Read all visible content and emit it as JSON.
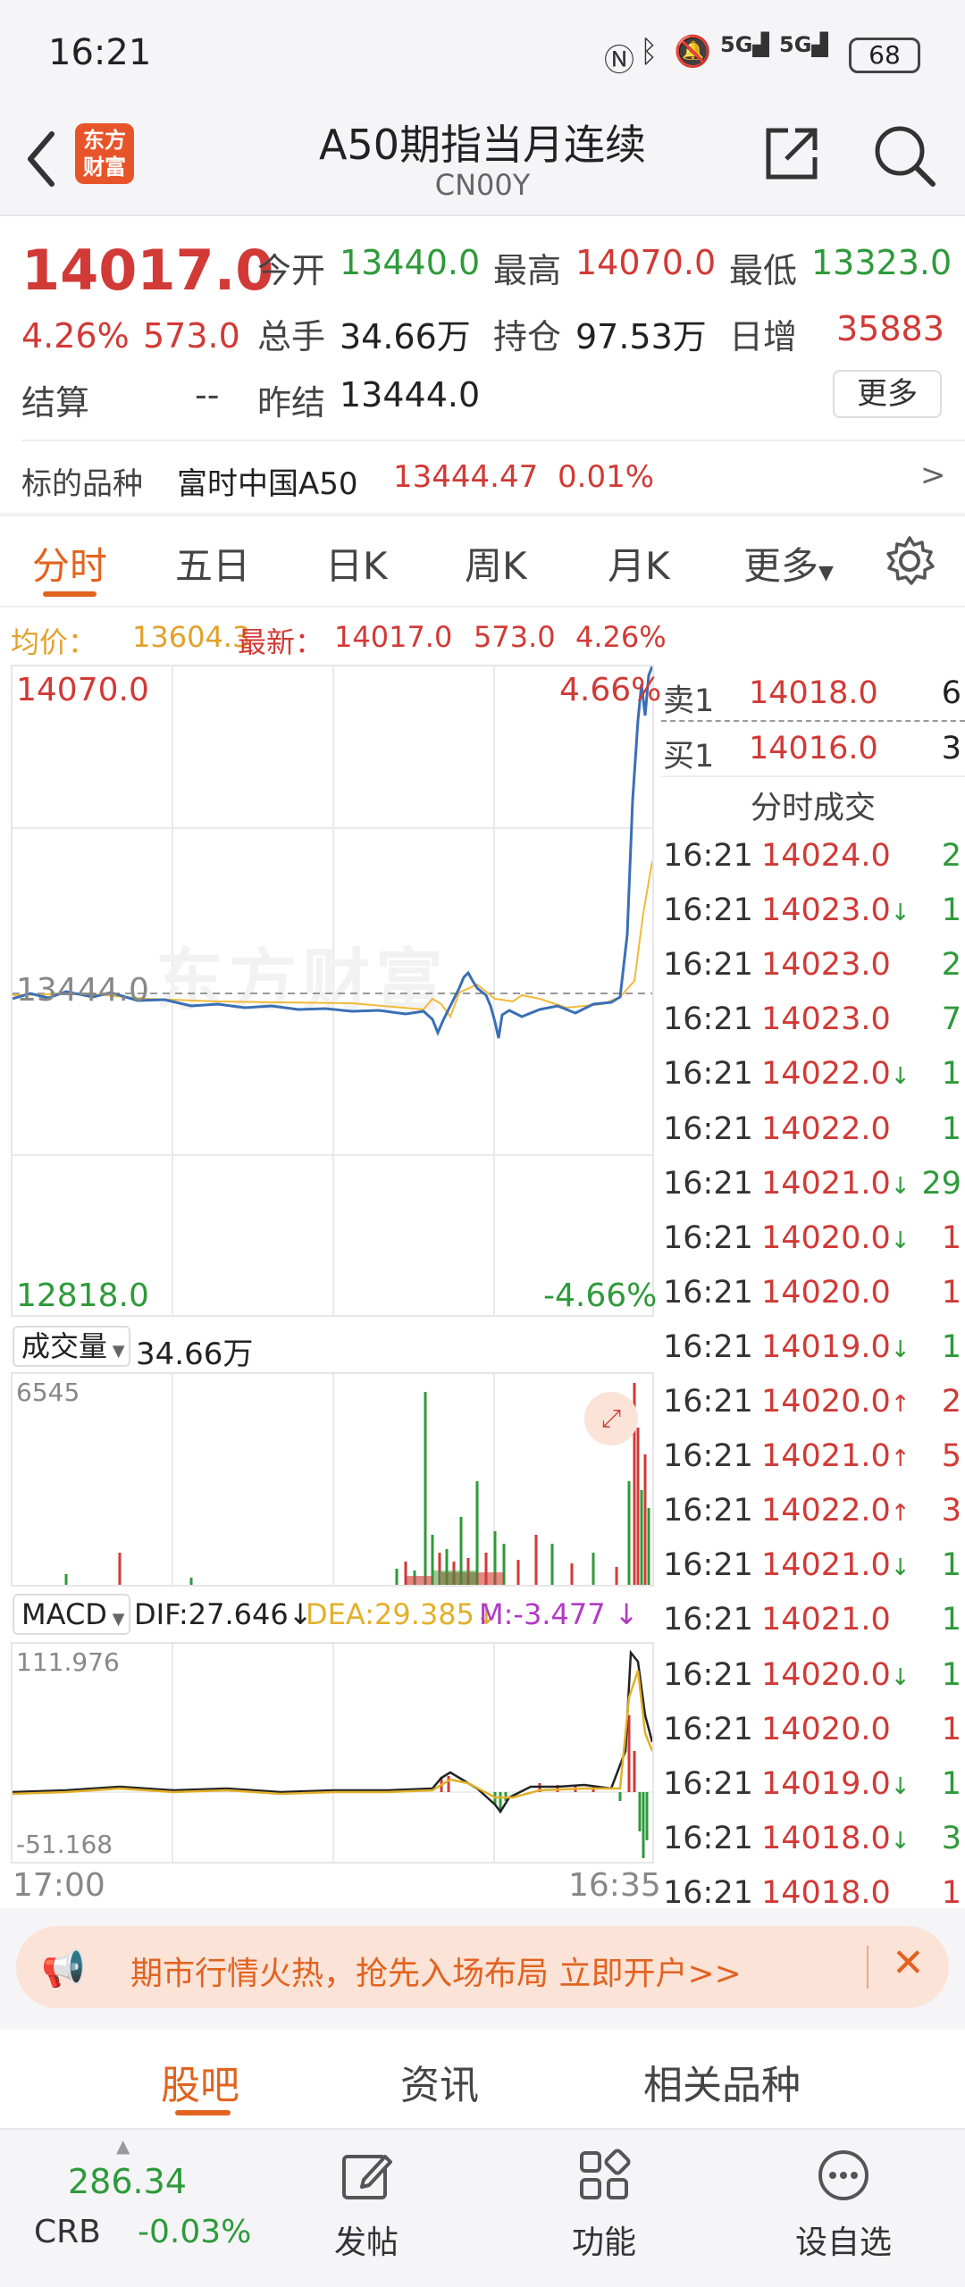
{
  "status_bar": {
    "time": "16:21",
    "battery": "68"
  },
  "header": {
    "title": "A50期指当月连续",
    "subtitle": "CN00Y",
    "logo_line1": "东方",
    "logo_line2": "财富"
  },
  "quote": {
    "price": "14017.0",
    "change_pct": "4.26%",
    "change": "573.0",
    "open_label": "今开",
    "open": "13440.0",
    "high_label": "最高",
    "high": "14070.0",
    "low_label": "最低",
    "low": "13323.0",
    "volume_label": "总手",
    "volume": "34.66万",
    "oi_label": "持仓",
    "oi": "97.53万",
    "daily_inc_label": "日增",
    "daily_inc": "35883",
    "settle_label": "结算",
    "settle": "--",
    "prev_settle_label": "昨结",
    "prev_settle": "13444.0",
    "more_button": "更多"
  },
  "underlying": {
    "label": "标的品种",
    "name": "富时中国A50",
    "price": "13444.47",
    "pct": "0.01%",
    "arrow": ">"
  },
  "tabs": [
    "分时",
    "五日",
    "日K",
    "周K",
    "月K",
    "更多"
  ],
  "chart_info": {
    "avg_label": "均价：",
    "avg": "13604.3",
    "latest_label": "最新：",
    "latest": "14017.0",
    "change": "573.0",
    "pct": "4.26%"
  },
  "chart_axis": {
    "top": "14070.0",
    "top_pct": "4.66%",
    "mid": "13444.0",
    "bottom": "12818.0",
    "bottom_pct": "-4.66%",
    "time_start": "17:00",
    "time_end": "16:35"
  },
  "watermark": "东方财富",
  "volume_panel": {
    "selector": "成交量",
    "value": "34.66万",
    "max": "6545"
  },
  "macd_panel": {
    "selector": "MACD",
    "dif": "DIF:27.646",
    "dea": "DEA:29.385",
    "m": "M:-3.477",
    "max": "111.976",
    "min": "-51.168"
  },
  "orderbook": {
    "sell_label": "卖1",
    "sell_price": "14018.0",
    "sell_qty": "6",
    "buy_label": "买1",
    "buy_price": "14016.0",
    "buy_qty": "3",
    "trades_title": "分时成交"
  },
  "trades": [
    {
      "time": "16:21",
      "price": "14024.0",
      "dir": "",
      "qty": "2",
      "qc": "green"
    },
    {
      "time": "16:21",
      "price": "14023.0",
      "dir": "↓",
      "qty": "1",
      "qc": "green"
    },
    {
      "time": "16:21",
      "price": "14023.0",
      "dir": "",
      "qty": "2",
      "qc": "green"
    },
    {
      "time": "16:21",
      "price": "14023.0",
      "dir": "",
      "qty": "7",
      "qc": "green"
    },
    {
      "time": "16:21",
      "price": "14022.0",
      "dir": "↓",
      "qty": "1",
      "qc": "green"
    },
    {
      "time": "16:21",
      "price": "14022.0",
      "dir": "",
      "qty": "1",
      "qc": "green"
    },
    {
      "time": "16:21",
      "price": "14021.0",
      "dir": "↓",
      "qty": "29",
      "qc": "green"
    },
    {
      "time": "16:21",
      "price": "14020.0",
      "dir": "↓",
      "qty": "1",
      "qc": "red"
    },
    {
      "time": "16:21",
      "price": "14020.0",
      "dir": "",
      "qty": "1",
      "qc": "red"
    },
    {
      "time": "16:21",
      "price": "14019.0",
      "dir": "↓",
      "qty": "1",
      "qc": "green"
    },
    {
      "time": "16:21",
      "price": "14020.0",
      "dir": "↑",
      "qty": "2",
      "qc": "red"
    },
    {
      "time": "16:21",
      "price": "14021.0",
      "dir": "↑",
      "qty": "5",
      "qc": "red"
    },
    {
      "time": "16:21",
      "price": "14022.0",
      "dir": "↑",
      "qty": "3",
      "qc": "red"
    },
    {
      "time": "16:21",
      "price": "14021.0",
      "dir": "↓",
      "qty": "1",
      "qc": "green"
    },
    {
      "time": "16:21",
      "price": "14021.0",
      "dir": "",
      "qty": "1",
      "qc": "green"
    },
    {
      "time": "16:21",
      "price": "14020.0",
      "dir": "↓",
      "qty": "1",
      "qc": "green"
    },
    {
      "time": "16:21",
      "price": "14020.0",
      "dir": "",
      "qty": "1",
      "qc": "red"
    },
    {
      "time": "16:21",
      "price": "14019.0",
      "dir": "↓",
      "qty": "1",
      "qc": "green"
    },
    {
      "time": "16:21",
      "price": "14018.0",
      "dir": "↓",
      "qty": "3",
      "qc": "green"
    },
    {
      "time": "16:21",
      "price": "14018.0",
      "dir": "",
      "qty": "1",
      "qc": "red"
    }
  ],
  "banner": {
    "text": "期市行情火热，抢先入场布局 立即开户>>"
  },
  "bottom_tabs": [
    "股吧",
    "资讯",
    "相关品种"
  ],
  "bottom_nav": {
    "index_value": "286.34",
    "index_name": "CRB",
    "index_change": "-0.03%",
    "post": "发帖",
    "func": "功能",
    "fav": "设自选"
  },
  "colors": {
    "up": "#d13a36",
    "down": "#2e9a3a",
    "accent": "#e2631f",
    "price_line": "#3a6fb5",
    "avg_line": "#f1b93a"
  }
}
